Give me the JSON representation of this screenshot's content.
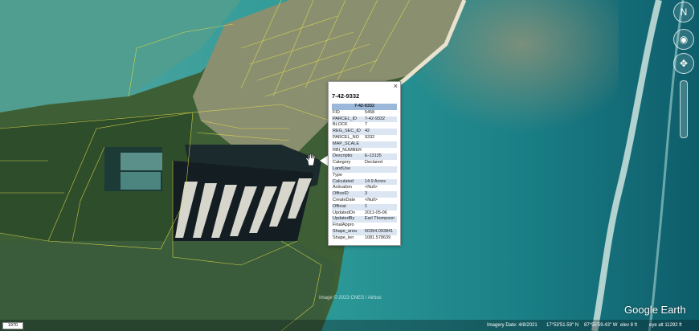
{
  "popup": {
    "title": "7-42-9332",
    "header": "7-42-9332",
    "close": "×",
    "rows": [
      {
        "key": "FID",
        "value": "5458"
      },
      {
        "key": "PARCEL_ID",
        "value": "7-42-9332"
      },
      {
        "key": "BLOCK",
        "value": "7"
      },
      {
        "key": "REG_SEC_ID",
        "value": "42"
      },
      {
        "key": "PARCEL_NO",
        "value": "9332"
      },
      {
        "key": "MAP_SCALE",
        "value": ""
      },
      {
        "key": "RBI_NUMBER",
        "value": ""
      },
      {
        "key": "Descriptio",
        "value": "E-13135"
      },
      {
        "key": "Category",
        "value": "Declared"
      },
      {
        "key": "LandUse",
        "value": ""
      },
      {
        "key": "Type",
        "value": ""
      },
      {
        "key": "Calculated",
        "value": "14.9 Acres"
      },
      {
        "key": "Activation",
        "value": "<Null>"
      },
      {
        "key": "OfficeID",
        "value": "3"
      },
      {
        "key": "CreateDate",
        "value": "<Null>"
      },
      {
        "key": "Official",
        "value": "1"
      },
      {
        "key": "UpdatedOn",
        "value": "2011-05-06"
      },
      {
        "key": "UpdatedBy",
        "value": "Earl Thompson"
      },
      {
        "key": "FinalAppro",
        "value": ""
      },
      {
        "key": "Shape_area",
        "value": "60394.093841"
      },
      {
        "key": "Shape_len",
        "value": "1081.578639"
      }
    ]
  },
  "status": {
    "scale": "1970",
    "imagery_date": "Imagery Date: 4/8/2021",
    "lat": "17°53'51.59\" N",
    "lon": "87°55'59.43\" W",
    "elev": "elev 8 ft",
    "eye_alt": "eye alt 11292 ft"
  },
  "credit": "Image © 2023 CNES / Airbus",
  "logo": "Google Earth",
  "colors": {
    "ocean": "#1f8a8a",
    "deep_ocean": "#0f5f6a",
    "land": "#3c5a33",
    "parcel_lines": "#e6e04a",
    "header_row": "#9bb7da"
  },
  "icons": {
    "compass": "compass-icon",
    "look": "look-joystick-icon",
    "move": "move-joystick-icon",
    "cursor": "hand-cursor-icon"
  }
}
